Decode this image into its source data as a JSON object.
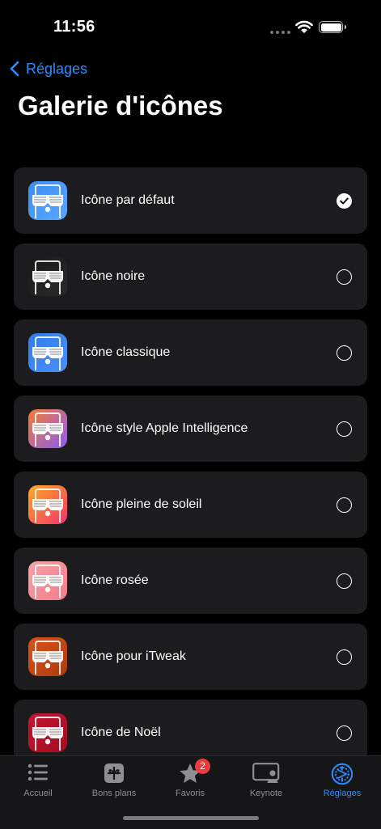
{
  "status_bar": {
    "time": "11:56"
  },
  "nav": {
    "back_label": "Réglages",
    "title": "Galerie d'icônes"
  },
  "icons": [
    {
      "label": "Icône par défaut",
      "selected": true,
      "bg": "#3b8df5",
      "bg2": "#5aa7ff"
    },
    {
      "label": "Icône noire",
      "selected": false,
      "bg": "#1a1a1a",
      "bg2": "#2a2a2a"
    },
    {
      "label": "Icône classique",
      "selected": false,
      "bg": "#2f7cf0",
      "bg2": "#4c90f7"
    },
    {
      "label": "Icône style Apple Intelligence",
      "selected": false,
      "bg": "#f77b2d",
      "bg2": "#8b5cf6"
    },
    {
      "label": "Icône pleine de soleil",
      "selected": false,
      "bg": "#ffab1e",
      "bg2": "#f2336e"
    },
    {
      "label": "Icône rosée",
      "selected": false,
      "bg": "#f6a1a7",
      "bg2": "#f47c8a"
    },
    {
      "label": "Icône pour iTweak",
      "selected": false,
      "bg": "#d9531a",
      "bg2": "#b03a10"
    },
    {
      "label": "Icône de Noël",
      "selected": false,
      "bg": "#c81530",
      "bg2": "#a00d22"
    }
  ],
  "tabs": [
    {
      "label": "Accueil",
      "icon": "list-icon"
    },
    {
      "label": "Bons plans",
      "icon": "gift-icon"
    },
    {
      "label": "Favoris",
      "icon": "star-icon",
      "badge": "2"
    },
    {
      "label": "Keynote",
      "icon": "keynote-icon"
    },
    {
      "label": "Réglages",
      "icon": "gear-icon",
      "active": true
    }
  ],
  "colors": {
    "accent": "#2f8cff",
    "row_bg": "#1c1c1e",
    "badge": "#eb3b3b"
  }
}
